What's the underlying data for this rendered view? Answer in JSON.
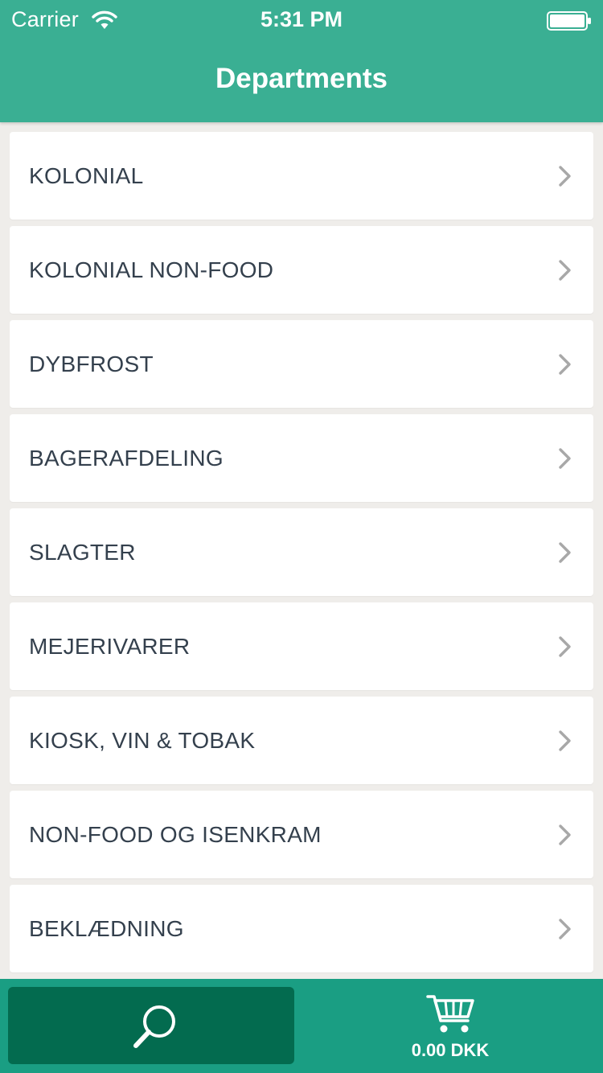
{
  "status_bar": {
    "carrier": "Carrier",
    "time": "5:31 PM",
    "wifi_icon": "wifi-icon",
    "battery_icon": "battery-icon"
  },
  "nav": {
    "title": "Departments"
  },
  "departments": [
    {
      "label": "KOLONIAL"
    },
    {
      "label": "KOLONIAL NON-FOOD"
    },
    {
      "label": "DYBFROST"
    },
    {
      "label": "BAGERAFDELING"
    },
    {
      "label": "SLAGTER"
    },
    {
      "label": "MEJERIVARER"
    },
    {
      "label": "KIOSK, VIN & TOBAK"
    },
    {
      "label": "NON-FOOD OG ISENKRAM"
    },
    {
      "label": "BEKLÆDNING"
    }
  ],
  "bottom_bar": {
    "search_icon": "search-icon",
    "cart_icon": "shopping-cart-icon",
    "cart_total": "0.00 DKK"
  },
  "colors": {
    "header": "#3aaf93",
    "bottom_bar": "#1a9e83",
    "search_button": "#036b4f",
    "background": "#efedea",
    "item_text": "#34404d",
    "chevron": "#a8a8a8"
  }
}
